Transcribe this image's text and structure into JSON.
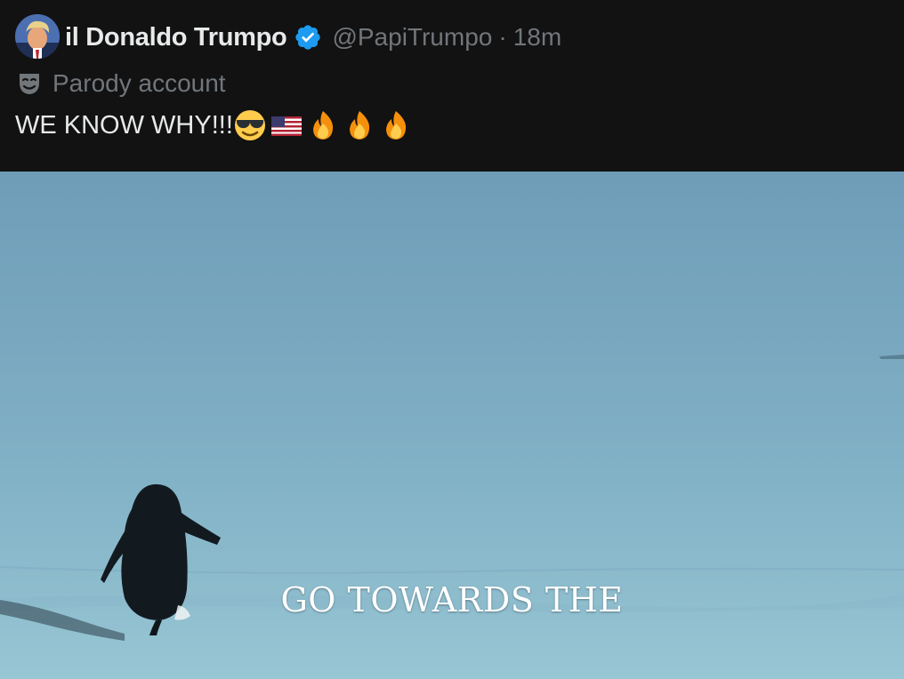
{
  "author": {
    "display_name": "il Donaldo Trumpo",
    "handle": "@PapiTrumpo",
    "separator": "·",
    "timestamp": "18m",
    "verified": true,
    "verified_color": "#1d9bf0"
  },
  "account_label": {
    "icon": "theater-mask-icon",
    "text": "Parody account"
  },
  "tweet": {
    "text": "WE KNOW WHY!!!",
    "emojis": [
      "smiling-face-with-sunglasses",
      "us-flag",
      "fire",
      "fire",
      "fire"
    ]
  },
  "media": {
    "caption": "GO TOWARDS THE"
  },
  "colors": {
    "background": "#121212",
    "primary_text": "#e7e9ea",
    "secondary_text": "#71767b"
  }
}
